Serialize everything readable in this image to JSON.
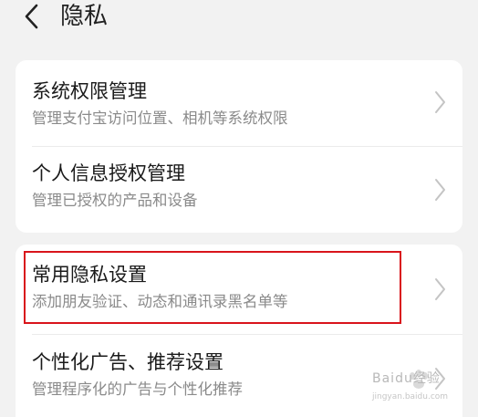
{
  "header": {
    "back_icon": "chevron-left-icon",
    "title": "隐私"
  },
  "groups": [
    {
      "items": [
        {
          "title": "系统权限管理",
          "subtitle": "管理支付宝访问位置、相机等系统权限"
        },
        {
          "title": "个人信息授权管理",
          "subtitle": "管理已授权的产品和设备"
        }
      ]
    },
    {
      "items": [
        {
          "title": "常用隐私设置",
          "subtitle": "添加朋友验证、动态和通讯录黑名单等",
          "highlighted": true
        },
        {
          "title": "个性化广告、推荐设置",
          "subtitle": "管理程序化的广告与个性化推荐"
        }
      ]
    }
  ],
  "row_icon": "chevron-right-icon",
  "highlight_color": "#d9141b",
  "watermark": {
    "text": "Baidu经验",
    "url": "jingyan.baidu.com"
  }
}
